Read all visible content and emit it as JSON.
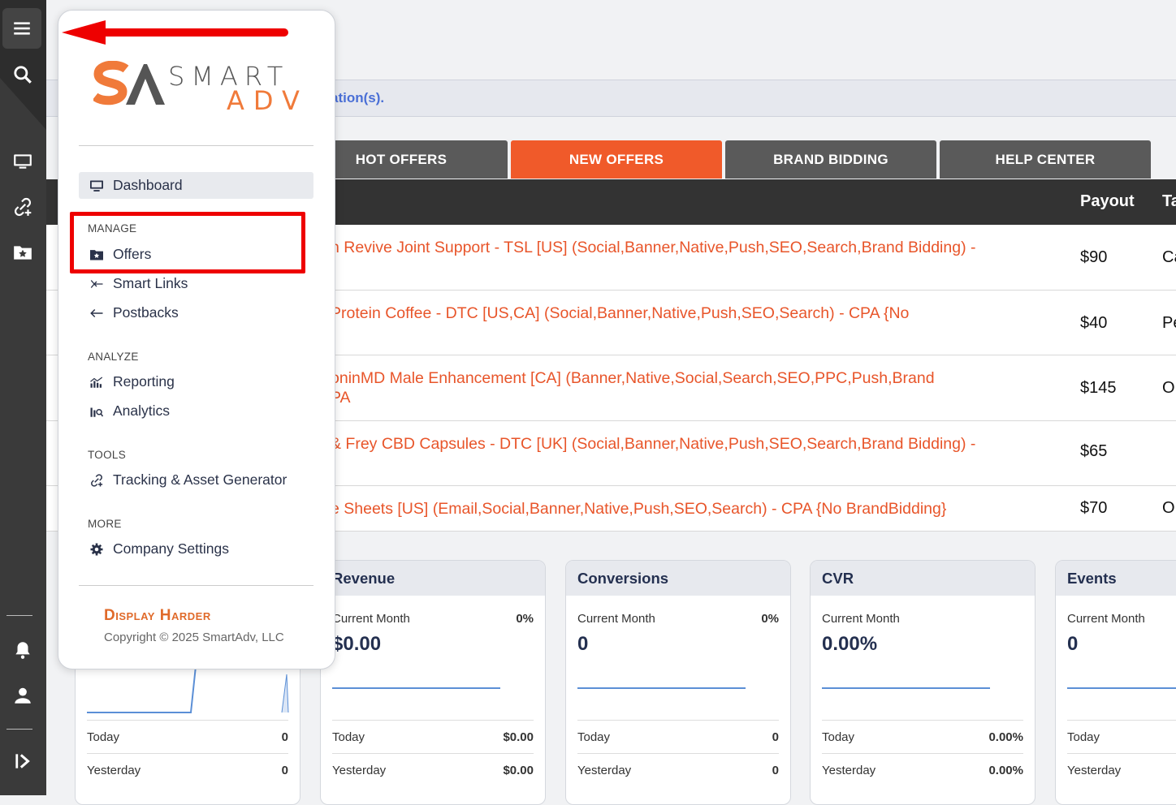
{
  "rail": {
    "top_items": [
      "menu-icon",
      "search-icon"
    ],
    "mid_items": [
      "monitor-icon",
      "link-plus-icon",
      "folder-star-icon"
    ],
    "bottom_items": [
      "bell-icon",
      "user-icon",
      "collapse-icon"
    ]
  },
  "menu": {
    "logo": {
      "smart": "SMART",
      "adv": "ADV"
    },
    "dashboard": "Dashboard",
    "sections": {
      "manage": "MANAGE",
      "analyze": "ANALYZE",
      "tools": "TOOLS",
      "more": "MORE"
    },
    "items": {
      "offers": "Offers",
      "smart_links": "Smart Links",
      "postbacks": "Postbacks",
      "reporting": "Reporting",
      "analytics": "Analytics",
      "tracking": "Tracking & Asset Generator",
      "company_settings": "Company Settings"
    },
    "brand": "Display Harder",
    "copyright": "Copyright © 2025 SmartAdv, LLC"
  },
  "notice": {
    "text": "ation(s)."
  },
  "tabs": [
    {
      "label": "HOT OFFERS",
      "active": false
    },
    {
      "label": "NEW OFFERS",
      "active": true
    },
    {
      "label": "BRAND BIDDING",
      "active": false
    },
    {
      "label": "HELP CENTER",
      "active": false
    }
  ],
  "table": {
    "headers": {
      "payout": "Payout",
      "next": "Ta"
    },
    "rows": [
      {
        "name": "n Revive Joint Support - TSL [US] (Social,Banner,Native,Push,SEO,Search,Brand Bidding) -",
        "name2": "",
        "payout": "$90",
        "extra": "Ca"
      },
      {
        "name": "Protein Coffee - DTC [US,CA] (Social,Banner,Native,Push,SEO,Search) - CPA {No",
        "name2": "",
        "payout": "$40",
        "extra": "Pe"
      },
      {
        "name": "oninMD Male Enhancement [CA] (Banner,Native,Social,Search,SEO,PPC,Push,Brand",
        "name2": "PA",
        "payout": "$145",
        "extra": "O"
      },
      {
        "name": "& Frey CBD Capsules - DTC [UK] (Social,Banner,Native,Push,SEO,Search,Brand Bidding) -",
        "name2": "",
        "payout": "$65",
        "extra": ""
      },
      {
        "name": "e Sheets [US] (Email,Social,Banner,Native,Push,SEO,Search) - CPA {No BrandBidding}",
        "name2": "",
        "payout": "$70",
        "extra": "O"
      }
    ]
  },
  "cards": [
    {
      "title": "",
      "sub": "",
      "pct": "",
      "value": "",
      "today_label": "Today",
      "today": "0",
      "yesterday_label": "Yesterday",
      "yesterday": "0"
    },
    {
      "title": "Revenue",
      "sub": "Current Month",
      "pct": "0%",
      "value": "$0.00",
      "today_label": "Today",
      "today": "$0.00",
      "yesterday_label": "Yesterday",
      "yesterday": "$0.00"
    },
    {
      "title": "Conversions",
      "sub": "Current Month",
      "pct": "0%",
      "value": "0",
      "today_label": "Today",
      "today": "0",
      "yesterday_label": "Yesterday",
      "yesterday": "0"
    },
    {
      "title": "CVR",
      "sub": "Current Month",
      "pct": "",
      "value": "0.00%",
      "today_label": "Today",
      "today": "0.00%",
      "yesterday_label": "Yesterday",
      "yesterday": "0.00%"
    },
    {
      "title": "Events",
      "sub": "Current Month",
      "pct": "",
      "value": "0",
      "today_label": "Today",
      "today": "",
      "yesterday_label": "Yesterday",
      "yesterday": ""
    }
  ],
  "colors": {
    "accent": "#f05a2a",
    "tab": "#5a5a5a",
    "annotation": "#ee0000",
    "link": "#4a6fd6"
  }
}
